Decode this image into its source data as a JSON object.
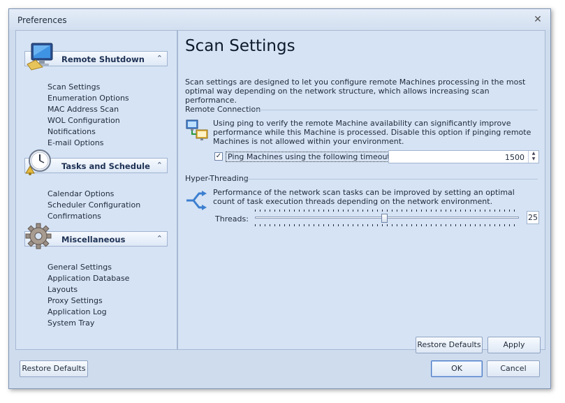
{
  "window": {
    "title": "Preferences",
    "close_glyph": "✕"
  },
  "sidebar": {
    "sections": [
      {
        "title": "Remote Shutdown",
        "icon": "monitor-icon",
        "items": [
          "Scan Settings",
          "Enumeration Options",
          "MAC Address Scan",
          "WOL Configuration",
          "Notifications",
          "E-mail Options"
        ]
      },
      {
        "title": "Tasks and Schedule",
        "icon": "clock-icon",
        "items": [
          "Calendar Options",
          "Scheduler Configuration",
          "Confirmations"
        ]
      },
      {
        "title": "Miscellaneous",
        "icon": "gear-icon",
        "items": [
          "General Settings",
          "Application Database",
          "Layouts",
          "Proxy Settings",
          "Application Log",
          "System Tray"
        ]
      }
    ],
    "collapse_glyph": "⌃"
  },
  "main": {
    "title": "Scan Settings",
    "description": "Scan settings are designed to let you configure remote Machines processing in the most optimal way depending on the network structure, which allows increasing scan performance.",
    "remote_connection": {
      "title": "Remote Connection",
      "description": "Using ping to verify the remote Machine availability can significantly improve performance while this Machine is processed. Disable this option if pinging remote Machines is not allowed within your environment.",
      "checkbox_label": "Ping Machines using the following timeout (ms.):",
      "checkbox_checked": true,
      "checkbox_glyph": "✓",
      "timeout_value": "1500",
      "spin_up_glyph": "▲",
      "spin_down_glyph": "▼"
    },
    "hyper_threading": {
      "title": "Hyper-Threading",
      "description": "Performance of the network scan tasks can be improved by setting an optimal count of task execution threads depending on the network environment.",
      "threads_label": "Threads:",
      "threads_value": "25",
      "slider_fraction": 0.49
    },
    "restore_defaults_label": "Restore Defaults",
    "apply_label": "Apply"
  },
  "footer": {
    "restore_defaults_label": "Restore Defaults",
    "ok_label": "OK",
    "cancel_label": "Cancel"
  },
  "colors": {
    "window_bg": "#cfdcee",
    "panel_bg": "#d6e3f4",
    "accent_border": "#4a78c2"
  }
}
